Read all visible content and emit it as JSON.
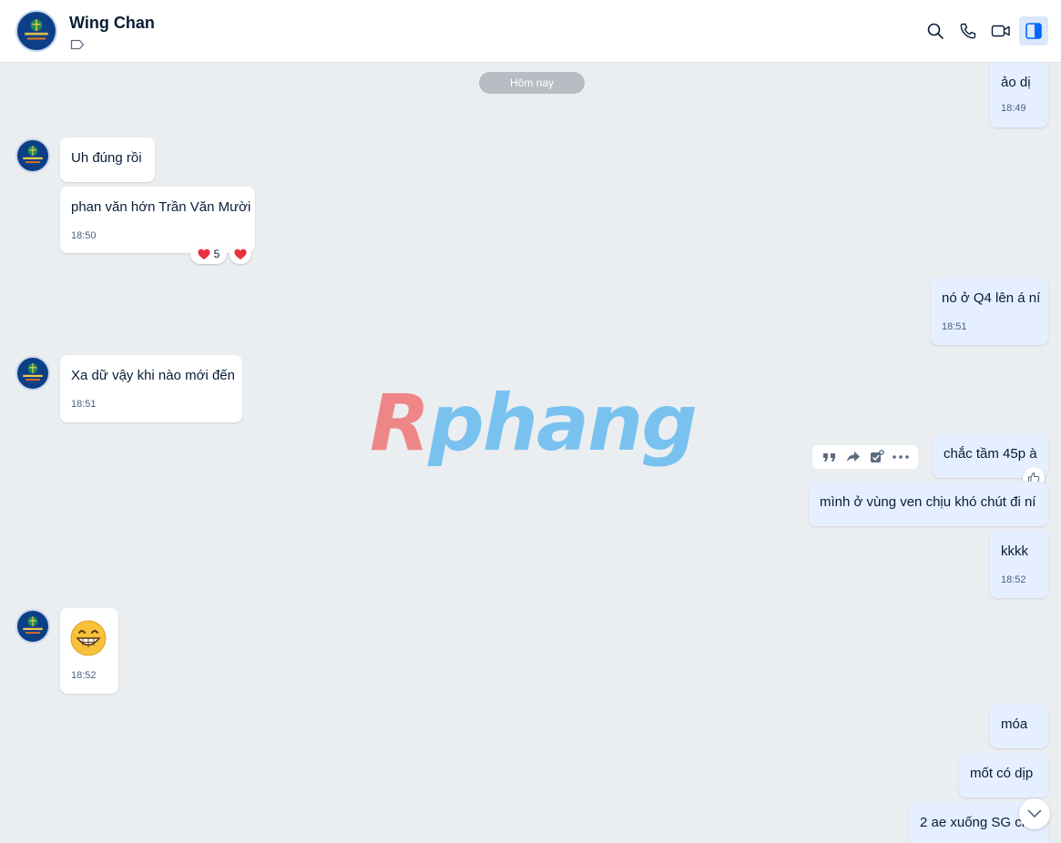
{
  "header": {
    "contact_name": "Wing Chan"
  },
  "date_separator": "Hôm nay",
  "watermark": "Rphang",
  "messages": [
    {
      "direction": "out",
      "text": "ảo dị",
      "time": "18:49"
    },
    {
      "direction": "in",
      "text": "Uh đúng rồi",
      "time": ""
    },
    {
      "direction": "in",
      "text": "phan văn hớn Trần Văn Mười",
      "time": "18:50"
    },
    {
      "direction": "out",
      "text": "nó ở Q4 lên á ní",
      "time": "18:51"
    },
    {
      "direction": "in",
      "text": "Xa dữ vậy khi nào mới đến",
      "time": "18:51"
    },
    {
      "direction": "out",
      "text": "chắc tầm 45p à",
      "time": ""
    },
    {
      "direction": "out",
      "text": "mình ở vùng ven chịu khó chút đi ní",
      "time": ""
    },
    {
      "direction": "out",
      "text": "kkkk",
      "time": "18:52"
    },
    {
      "direction": "in",
      "text": "",
      "time": "18:52",
      "emoji": "grinning-face"
    },
    {
      "direction": "out",
      "text": "móa",
      "time": ""
    },
    {
      "direction": "out",
      "text": "mốt có dịp",
      "time": ""
    },
    {
      "direction": "out",
      "text": "2 ae xuống SG ch",
      "time": ""
    }
  ],
  "reactions": {
    "heart_count": "5"
  },
  "colors": {
    "incoming_bubble": "#ffffff",
    "outgoing_bubble": "#e5efff",
    "chat_background": "#ebeef1",
    "accent": "#0068ff"
  }
}
